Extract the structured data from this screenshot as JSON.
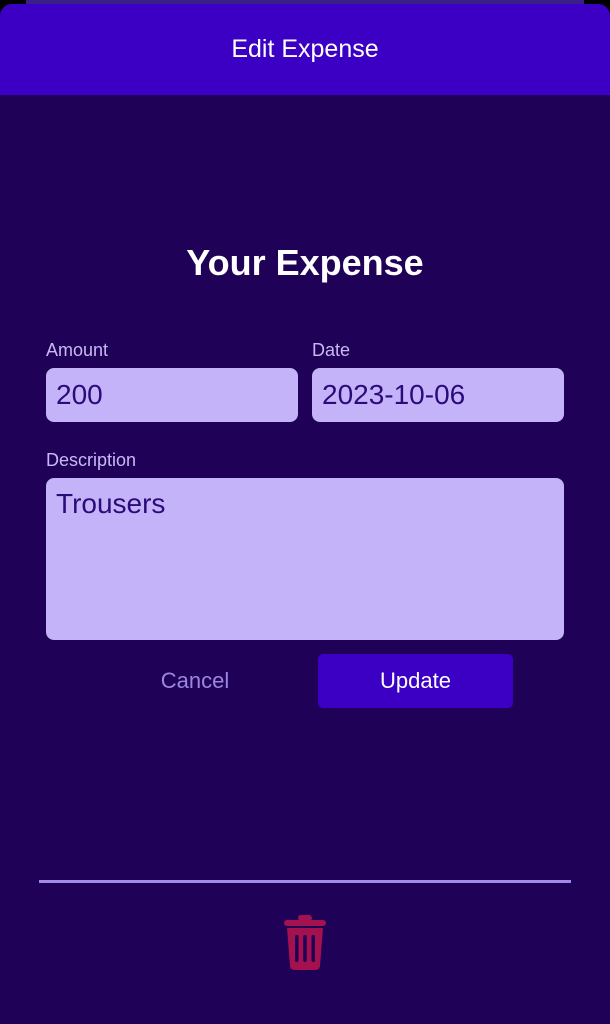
{
  "header": {
    "title": "Edit Expense"
  },
  "form": {
    "title": "Your Expense",
    "amount_label": "Amount",
    "amount_value": "200",
    "date_label": "Date",
    "date_value": "2023-10-06",
    "description_label": "Description",
    "description_value": "Trousers",
    "cancel_label": "Cancel",
    "update_label": "Update"
  },
  "icons": {
    "delete": "trash-icon"
  },
  "colors": {
    "header": "#3c00c4",
    "background": "#1f0257",
    "input": "#c5b3fa",
    "delete": "#a3114f"
  }
}
